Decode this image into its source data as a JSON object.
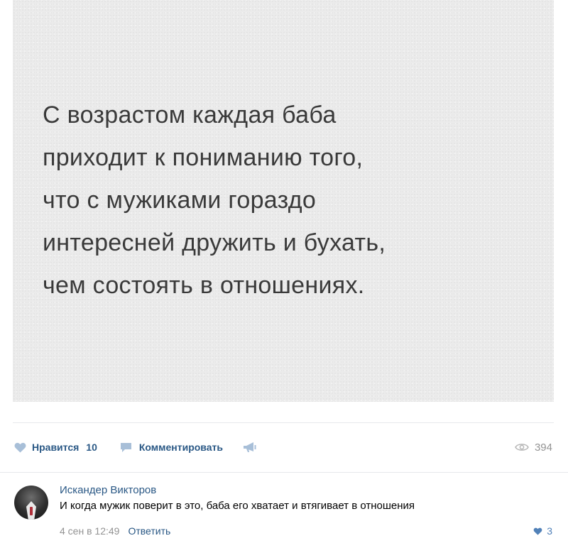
{
  "post": {
    "quote_lines": [
      "С возрастом каждая баба",
      "приходит к пониманию того,",
      "что с мужиками гораздо",
      "интересней дружить и бухать,",
      "чем состоять в отношениях."
    ]
  },
  "actions": {
    "like_label": "Нравится",
    "like_count": "10",
    "comment_label": "Комментировать",
    "views_count": "394"
  },
  "comment": {
    "author": "Искандер Викторов",
    "text": "И когда мужик поверит в это, баба его хватает и втягивает в отношения",
    "date": "4 сен в 12:49",
    "reply_label": "Ответить",
    "likes": "3"
  },
  "icons": {
    "like": "heart-icon",
    "comment": "speech-bubble-icon",
    "share": "megaphone-icon",
    "views": "eye-icon",
    "comment_like": "heart-icon"
  },
  "colors": {
    "link": "#2a5885",
    "muted": "#939393",
    "icon": "#a8bfd8",
    "comment_like": "#5181b8"
  }
}
